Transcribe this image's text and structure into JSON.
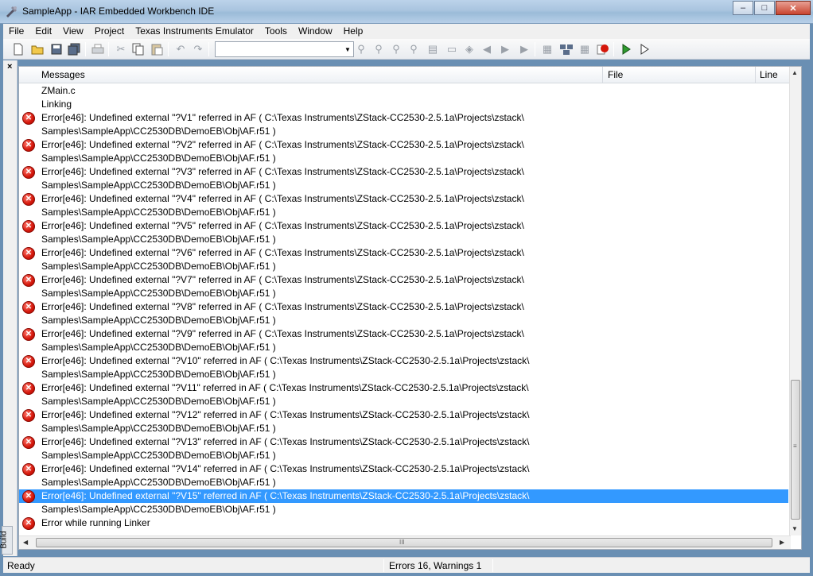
{
  "window": {
    "title": "SampleApp - IAR Embedded Workbench IDE",
    "min": "–",
    "max": "□",
    "close": "✕"
  },
  "menu": [
    "File",
    "Edit",
    "View",
    "Project",
    "Texas Instruments Emulator",
    "Tools",
    "Window",
    "Help"
  ],
  "toolbar": {
    "config_value": ""
  },
  "panel": {
    "close": "×",
    "tab_label": "Build",
    "columns": {
      "messages": "Messages",
      "file": "File",
      "line": "Line"
    },
    "messages": [
      {
        "text": "ZMain.c",
        "error": false
      },
      {
        "text": "Linking",
        "error": false
      },
      {
        "text": "Error[e46]: Undefined external \"?V1\" referred in AF ( C:\\Texas Instruments\\ZStack-CC2530-2.5.1a\\Projects\\zstack\\",
        "error": true
      },
      {
        "text": "Samples\\SampleApp\\CC2530DB\\DemoEB\\Obj\\AF.r51 )",
        "error": false
      },
      {
        "text": "Error[e46]: Undefined external \"?V2\" referred in AF ( C:\\Texas Instruments\\ZStack-CC2530-2.5.1a\\Projects\\zstack\\",
        "error": true
      },
      {
        "text": "Samples\\SampleApp\\CC2530DB\\DemoEB\\Obj\\AF.r51 )",
        "error": false
      },
      {
        "text": "Error[e46]: Undefined external \"?V3\" referred in AF ( C:\\Texas Instruments\\ZStack-CC2530-2.5.1a\\Projects\\zstack\\",
        "error": true
      },
      {
        "text": "Samples\\SampleApp\\CC2530DB\\DemoEB\\Obj\\AF.r51 )",
        "error": false
      },
      {
        "text": "Error[e46]: Undefined external \"?V4\" referred in AF ( C:\\Texas Instruments\\ZStack-CC2530-2.5.1a\\Projects\\zstack\\",
        "error": true
      },
      {
        "text": "Samples\\SampleApp\\CC2530DB\\DemoEB\\Obj\\AF.r51 )",
        "error": false
      },
      {
        "text": "Error[e46]: Undefined external \"?V5\" referred in AF ( C:\\Texas Instruments\\ZStack-CC2530-2.5.1a\\Projects\\zstack\\",
        "error": true
      },
      {
        "text": "Samples\\SampleApp\\CC2530DB\\DemoEB\\Obj\\AF.r51 )",
        "error": false
      },
      {
        "text": "Error[e46]: Undefined external \"?V6\" referred in AF ( C:\\Texas Instruments\\ZStack-CC2530-2.5.1a\\Projects\\zstack\\",
        "error": true
      },
      {
        "text": "Samples\\SampleApp\\CC2530DB\\DemoEB\\Obj\\AF.r51 )",
        "error": false
      },
      {
        "text": "Error[e46]: Undefined external \"?V7\" referred in AF ( C:\\Texas Instruments\\ZStack-CC2530-2.5.1a\\Projects\\zstack\\",
        "error": true
      },
      {
        "text": "Samples\\SampleApp\\CC2530DB\\DemoEB\\Obj\\AF.r51 )",
        "error": false
      },
      {
        "text": "Error[e46]: Undefined external \"?V8\" referred in AF ( C:\\Texas Instruments\\ZStack-CC2530-2.5.1a\\Projects\\zstack\\",
        "error": true
      },
      {
        "text": "Samples\\SampleApp\\CC2530DB\\DemoEB\\Obj\\AF.r51 )",
        "error": false
      },
      {
        "text": "Error[e46]: Undefined external \"?V9\" referred in AF ( C:\\Texas Instruments\\ZStack-CC2530-2.5.1a\\Projects\\zstack\\",
        "error": true
      },
      {
        "text": "Samples\\SampleApp\\CC2530DB\\DemoEB\\Obj\\AF.r51 )",
        "error": false
      },
      {
        "text": "Error[e46]: Undefined external \"?V10\" referred in AF ( C:\\Texas Instruments\\ZStack-CC2530-2.5.1a\\Projects\\zstack\\",
        "error": true
      },
      {
        "text": "Samples\\SampleApp\\CC2530DB\\DemoEB\\Obj\\AF.r51 )",
        "error": false
      },
      {
        "text": "Error[e46]: Undefined external \"?V11\" referred in AF ( C:\\Texas Instruments\\ZStack-CC2530-2.5.1a\\Projects\\zstack\\",
        "error": true
      },
      {
        "text": "Samples\\SampleApp\\CC2530DB\\DemoEB\\Obj\\AF.r51 )",
        "error": false
      },
      {
        "text": "Error[e46]: Undefined external \"?V12\" referred in AF ( C:\\Texas Instruments\\ZStack-CC2530-2.5.1a\\Projects\\zstack\\",
        "error": true
      },
      {
        "text": "Samples\\SampleApp\\CC2530DB\\DemoEB\\Obj\\AF.r51 )",
        "error": false
      },
      {
        "text": "Error[e46]: Undefined external \"?V13\" referred in AF ( C:\\Texas Instruments\\ZStack-CC2530-2.5.1a\\Projects\\zstack\\",
        "error": true
      },
      {
        "text": "Samples\\SampleApp\\CC2530DB\\DemoEB\\Obj\\AF.r51 )",
        "error": false
      },
      {
        "text": "Error[e46]: Undefined external \"?V14\" referred in AF ( C:\\Texas Instruments\\ZStack-CC2530-2.5.1a\\Projects\\zstack\\",
        "error": true
      },
      {
        "text": "Samples\\SampleApp\\CC2530DB\\DemoEB\\Obj\\AF.r51 )",
        "error": false
      },
      {
        "text": "Error[e46]: Undefined external \"?V15\" referred in AF ( C:\\Texas Instruments\\ZStack-CC2530-2.5.1a\\Projects\\zstack\\",
        "error": true,
        "selected": true
      },
      {
        "text": "Samples\\SampleApp\\CC2530DB\\DemoEB\\Obj\\AF.r51 )",
        "error": false
      },
      {
        "text": "Error while running Linker",
        "error": true
      }
    ],
    "error_icon_glyph": "✕",
    "scroll": {
      "up": "▲",
      "down": "▼",
      "left": "◀",
      "right": "▶",
      "grip_v": "≡",
      "grip_h": "III"
    }
  },
  "status": {
    "left": "Ready",
    "middle": "Errors 16, Warnings 1"
  },
  "colors": {
    "selection": "#3399ff",
    "error": "#d4160a"
  }
}
